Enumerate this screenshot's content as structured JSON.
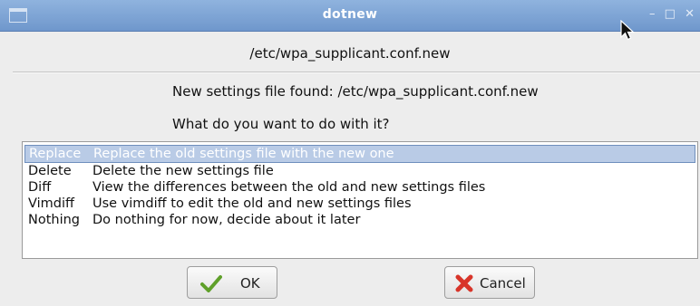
{
  "window": {
    "title": "dotnew",
    "controls": [
      "–",
      "□",
      "✕"
    ]
  },
  "dialog": {
    "path": "/etc/wpa_supplicant.conf.new",
    "message": "New settings file found: /etc/wpa_supplicant.conf.new",
    "question": "What do you want to do with it?"
  },
  "options": [
    {
      "key": "Replace",
      "desc": "Replace the old settings file with the new one",
      "selected": true
    },
    {
      "key": "Delete",
      "desc": "Delete the new settings file",
      "selected": false
    },
    {
      "key": "Diff",
      "desc": "View the differences between the old and new settings files",
      "selected": false
    },
    {
      "key": "Vimdiff",
      "desc": "Use vimdiff to edit the old and new settings files",
      "selected": false
    },
    {
      "key": "Nothing",
      "desc": "Do nothing for now, decide about it later",
      "selected": false
    }
  ],
  "buttons": {
    "ok_label": "OK",
    "ok_icon": "checkmark-icon",
    "cancel_label": "Cancel",
    "cancel_icon": "red-x-icon"
  },
  "colors": {
    "titlebar": "#7aa2d4",
    "selection": "#b9cbe6",
    "ok_icon": "#5fa02a",
    "cancel_icon": "#d8352a"
  }
}
